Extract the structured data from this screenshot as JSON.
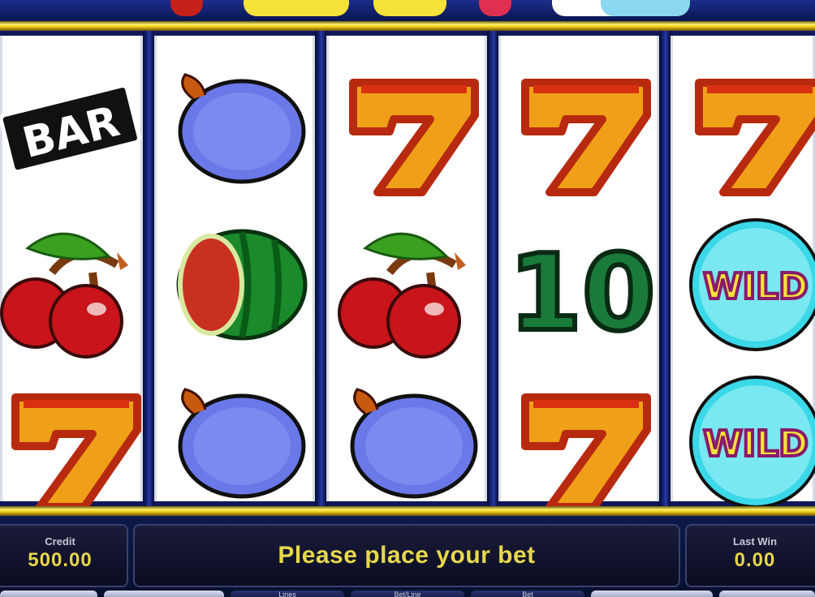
{
  "bottom_panel": {
    "credit_label": "Credit",
    "credit_value": "500.00",
    "message": "Please place your bet",
    "last_win_label": "Last Win",
    "last_win_value": "0.00",
    "controls": {
      "lines_label": "Lines",
      "bet_per_line_label": "Bet/Line",
      "bet_label": "Bet"
    }
  },
  "reels": [
    [
      "bar",
      "cherry",
      "seven"
    ],
    [
      "plum",
      "watermelon",
      "plum"
    ],
    [
      "seven",
      "cherry",
      "plum"
    ],
    [
      "seven",
      "ten",
      "seven"
    ],
    [
      "seven",
      "wild",
      "wild"
    ]
  ],
  "symbol_text": {
    "bar": "BAR",
    "ten": "10",
    "wild": "WILD"
  },
  "colors": {
    "gold": "#e8c612",
    "message": "#e6d84c",
    "background": "#0b1440"
  }
}
